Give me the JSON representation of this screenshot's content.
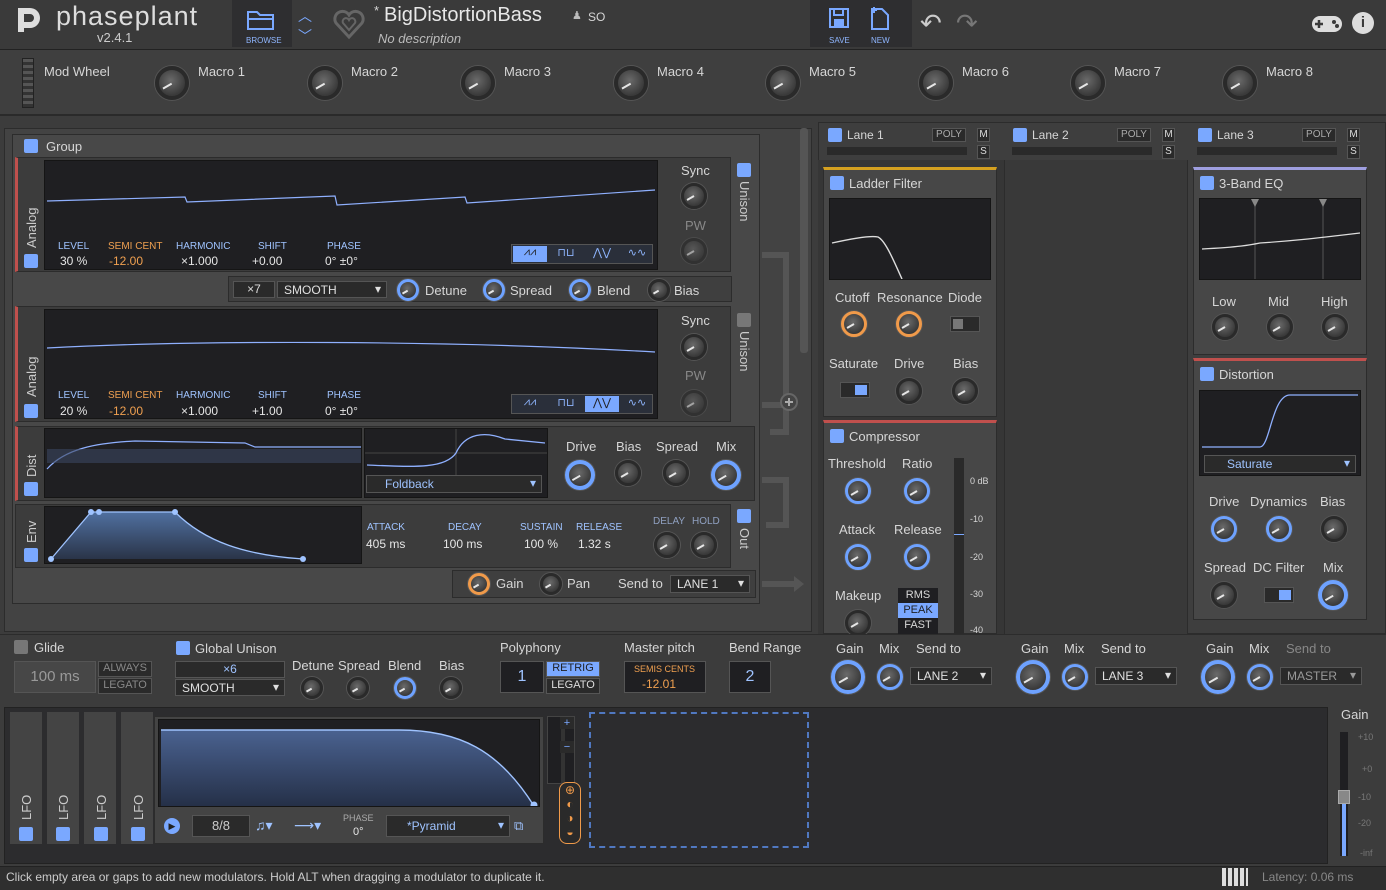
{
  "header": {
    "logo": "phaseplant",
    "version": "v2.4.1",
    "browse": "BROWSE",
    "preset_modified": "*",
    "preset": "BigDistortionBass",
    "author": "SO",
    "description": "No description",
    "save": "SAVE",
    "new": "NEW"
  },
  "macros": {
    "mod_wheel": "Mod Wheel",
    "items": [
      "Macro 1",
      "Macro 2",
      "Macro 3",
      "Macro 4",
      "Macro 5",
      "Macro 6",
      "Macro 7",
      "Macro 8"
    ]
  },
  "group": {
    "title": "Group"
  },
  "gen1": {
    "side": "Analog",
    "level_l": "LEVEL",
    "level": "30 %",
    "semi_l": "SEMI CENT",
    "semi": "-12.00",
    "harm_l": "HARMONIC",
    "harm": "×1.000",
    "shift_l": "SHIFT",
    "shift": "+0.00",
    "phase_l": "PHASE",
    "phase": "0° ±0°",
    "sync": "Sync",
    "pw": "PW",
    "unison": "Unison"
  },
  "unison_row": {
    "count": "×7",
    "mode": "SMOOTH",
    "detune": "Detune",
    "spread": "Spread",
    "blend": "Blend",
    "bias": "Bias"
  },
  "gen2": {
    "side": "Analog",
    "level_l": "LEVEL",
    "level": "20 %",
    "semi_l": "SEMI CENT",
    "semi": "-12.00",
    "harm_l": "HARMONIC",
    "harm": "×1.000",
    "shift_l": "SHIFT",
    "shift": "+1.00",
    "phase_l": "PHASE",
    "phase": "0° ±0°",
    "sync": "Sync",
    "pw": "PW",
    "unison": "Unison"
  },
  "dist": {
    "side": "Dist",
    "mode": "Foldback",
    "drive": "Drive",
    "bias": "Bias",
    "spread": "Spread",
    "mix": "Mix"
  },
  "env": {
    "side": "Env",
    "attack_l": "ATTACK",
    "attack": "405 ms",
    "decay_l": "DECAY",
    "decay": "100 ms",
    "sustain_l": "SUSTAIN",
    "sustain": "100 %",
    "release_l": "RELEASE",
    "release": "1.32 s",
    "delay": "DELAY",
    "hold": "HOLD",
    "out": "Out"
  },
  "out_row": {
    "gain": "Gain",
    "pan": "Pan",
    "send_to": "Send to",
    "lane": "LANE 1"
  },
  "lanes": [
    {
      "name": "Lane 1",
      "poly": "POLY",
      "m": "M",
      "s": "S"
    },
    {
      "name": "Lane 2",
      "poly": "POLY",
      "m": "M",
      "s": "S"
    },
    {
      "name": "Lane 3",
      "poly": "POLY",
      "m": "M",
      "s": "S"
    }
  ],
  "ladder": {
    "title": "Ladder Filter",
    "cutoff": "Cutoff",
    "resonance": "Resonance",
    "diode": "Diode",
    "saturate": "Saturate",
    "drive": "Drive",
    "bias": "Bias"
  },
  "comp": {
    "title": "Compressor",
    "threshold": "Threshold",
    "ratio": "Ratio",
    "attack": "Attack",
    "release": "Release",
    "makeup": "Makeup",
    "rms": "RMS",
    "peak": "PEAK",
    "fast": "FAST",
    "db": [
      "0 dB",
      "-10",
      "-20",
      "-30",
      "-40"
    ]
  },
  "eq": {
    "title": "3-Band EQ",
    "low": "Low",
    "mid": "Mid",
    "high": "High"
  },
  "distfx": {
    "title": "Distortion",
    "mode": "Saturate",
    "drive": "Drive",
    "dynamics": "Dynamics",
    "bias": "Bias",
    "spread": "Spread",
    "dc": "DC Filter",
    "mix": "Mix"
  },
  "lane_out": [
    {
      "gain": "Gain",
      "mix": "Mix",
      "send": "Send to",
      "dest": "LANE 2"
    },
    {
      "gain": "Gain",
      "mix": "Mix",
      "send": "Send to",
      "dest": "LANE 3"
    },
    {
      "gain": "Gain",
      "mix": "Mix",
      "send": "Send to",
      "dest": "MASTER"
    }
  ],
  "global": {
    "glide": "Glide",
    "glide_val": "100 ms",
    "always": "ALWAYS",
    "legato": "LEGATO",
    "gu": "Global Unison",
    "gu_count": "×6",
    "gu_mode": "SMOOTH",
    "detune": "Detune",
    "spread": "Spread",
    "blend": "Blend",
    "bias": "Bias",
    "poly": "Polyphony",
    "poly_val": "1",
    "retrig": "RETRIG",
    "poly_legato": "LEGATO",
    "mp": "Master pitch",
    "mp_l": "SEMIS CENTS",
    "mp_val": "-12.01",
    "bend": "Bend Range",
    "bend_val": "2"
  },
  "lfo": {
    "tabs": [
      "LFO",
      "LFO",
      "LFO",
      "LFO"
    ],
    "rate": "8/8",
    "phase_l": "PHASE",
    "phase": "0°",
    "shape": "*Pyramid"
  },
  "master": {
    "gain": "Gain",
    "ticks": [
      "+10",
      "+0",
      "-10",
      "-20",
      "-inf"
    ]
  },
  "status": {
    "hint": "Click empty area or gaps to add new modulators. Hold ALT when dragging a modulator to duplicate it.",
    "latency": "Latency: 0.06 ms"
  }
}
